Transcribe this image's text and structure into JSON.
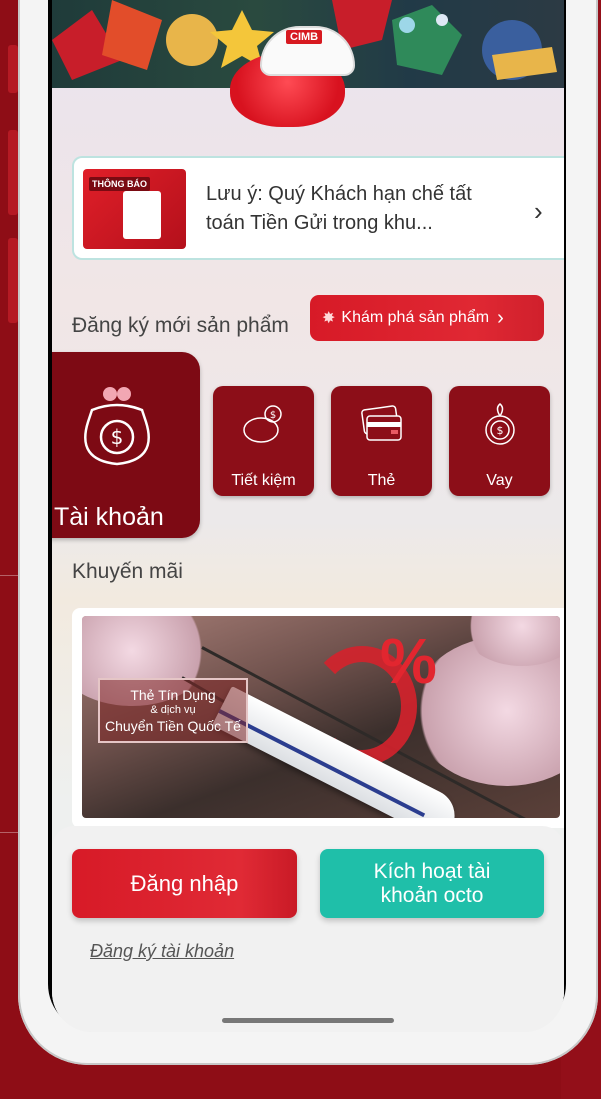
{
  "colors": {
    "brand_red": "#d71a27",
    "dark_red": "#8c0e18",
    "teal": "#1fbfa9",
    "background": "#8e0d16"
  },
  "hero": {
    "logo_text": "CIMB"
  },
  "notice": {
    "thumb_tag": "THÔNG BÁO",
    "text": "Lưu ý: Quý Khách hạn chế tất toán Tiền Gửi trong khu...",
    "chevron": "›"
  },
  "register": {
    "label": "Đăng ký mới sản phẩm",
    "explore_button": "Khám phá sản phẩm"
  },
  "products": [
    {
      "label": "Tài khoản",
      "icon": "money-bag-icon"
    },
    {
      "label": "Tiết kiệm",
      "icon": "piggy-bank-icon"
    },
    {
      "label": "Thẻ",
      "icon": "card-icon"
    },
    {
      "label": "Vay",
      "icon": "coin-plant-icon"
    }
  ],
  "promo": {
    "label": "Khuyến mãi",
    "caption_line1": "Thẻ Tín Dụng",
    "caption_line2": "& dịch vụ",
    "caption_line3": "Chuyển Tiền Quốc Tế",
    "percent": "%"
  },
  "actions": {
    "login": "Đăng nhập",
    "activate": "Kích hoạt tài khoản octo",
    "register_link": "Đăng ký tài khoản"
  }
}
